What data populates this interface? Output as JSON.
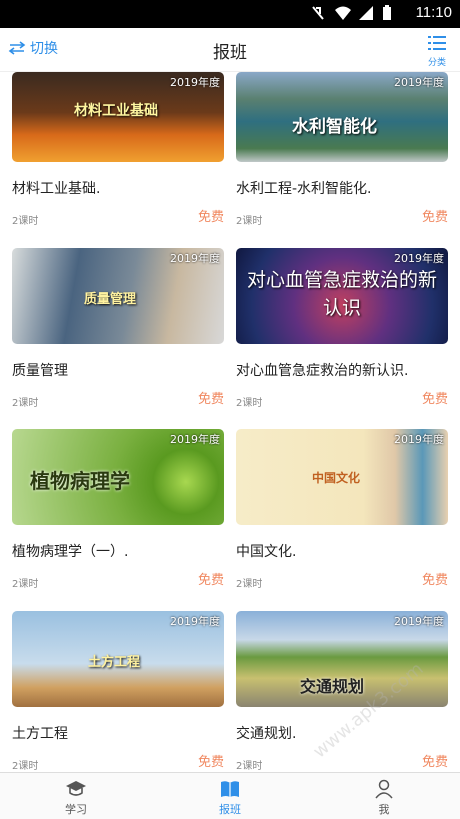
{
  "status": {
    "time": "11:10"
  },
  "header": {
    "switch_label": "切换",
    "title": "报班",
    "category_label": "分类"
  },
  "courses": [
    {
      "title": "材料工业基础.",
      "thumb_text": "材料工业基础",
      "year": "2019年度",
      "lessons": "2课时",
      "price": "免费"
    },
    {
      "title": "水利工程-水利智能化.",
      "thumb_text": "水利智能化",
      "year": "2019年度",
      "lessons": "2课时",
      "price": "免费"
    },
    {
      "title": "质量管理",
      "thumb_text": "质量管理",
      "year": "2019年度",
      "lessons": "2课时",
      "price": "免费"
    },
    {
      "title": "对心血管急症救治的新认识.",
      "thumb_text": "对心血管急症救治的新认识",
      "year": "2019年度",
      "lessons": "2课时",
      "price": "免费"
    },
    {
      "title": "植物病理学（一）.",
      "thumb_text": "植物病理学",
      "year": "2019年度",
      "lessons": "2课时",
      "price": "免费"
    },
    {
      "title": "中国文化.",
      "thumb_text": "中国文化",
      "year": "2019年度",
      "lessons": "2课时",
      "price": "免费"
    },
    {
      "title": "土方工程",
      "thumb_text": "土方工程",
      "year": "2019年度",
      "lessons": "2课时",
      "price": "免费"
    },
    {
      "title": "交通规划.",
      "thumb_text": "交通规划",
      "year": "2019年度",
      "lessons": "2课时",
      "price": "免费"
    }
  ],
  "tabs": [
    {
      "label": "学习",
      "icon": "graduation-cap-icon"
    },
    {
      "label": "报班",
      "icon": "book-icon"
    },
    {
      "label": "我",
      "icon": "person-icon"
    }
  ],
  "watermark": "www.apk3.com",
  "colors": {
    "accent": "#2f8fe8",
    "price": "#f08860"
  }
}
